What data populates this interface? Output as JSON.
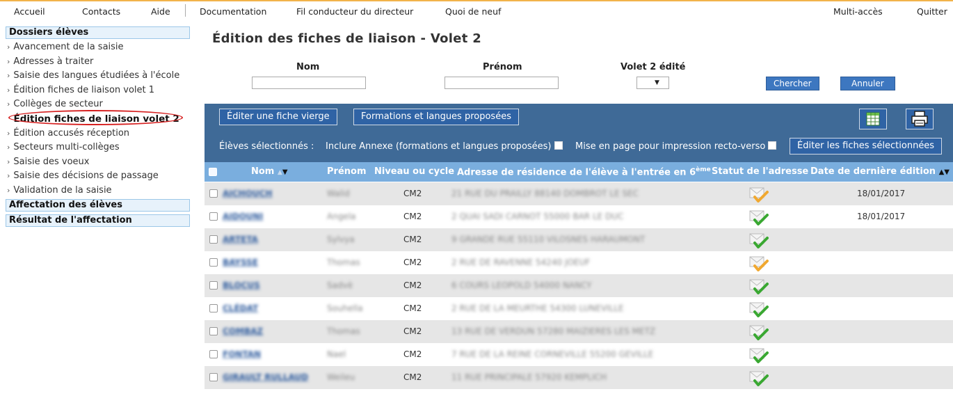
{
  "topmenu": {
    "left": [
      "Accueil",
      "Contacts",
      "Aide",
      "Documentation",
      "Fil conducteur du directeur",
      "Quoi de neuf"
    ],
    "right": [
      "Multi-accès",
      "Quitter"
    ]
  },
  "sidebar": {
    "section1": "Dossiers élèves",
    "items": [
      "Avancement de la saisie",
      "Adresses à traiter",
      "Saisie des langues étudiées à l'école",
      "Édition fiches de liaison volet 1",
      "Collèges de secteur",
      "Édition fiches de liaison volet 2",
      "Édition accusés réception",
      "Secteurs multi-collèges",
      "Saisie des voeux",
      "Saisie des décisions de passage",
      "Validation de la saisie"
    ],
    "active_index": 5,
    "section2": "Affectation des élèves",
    "section3": "Résultat de l'affectation",
    "chevron": "›"
  },
  "page": {
    "title": "Édition des fiches de liaison - Volet 2",
    "search": {
      "nom_label": "Nom",
      "nom_value": "",
      "prenom_label": "Prénom",
      "prenom_value": "",
      "volet_label": "Volet 2 édité",
      "volet_value": "",
      "search_button": "Chercher",
      "cancel_button": "Annuler"
    },
    "toolbar": {
      "blank_sheet_button": "Éditer une fiche vierge",
      "formations_button": "Formations et langues proposées",
      "selected_label": "Élèves sélectionnés :",
      "include_annex_label": "Inclure Annexe (formations et langues proposées)",
      "recto_verso_label": "Mise en page pour impression recto-verso",
      "edit_selected_button": "Éditer les fiches sélectionnées",
      "export_icon": "spreadsheet-icon",
      "print_icon": "printer-icon"
    },
    "table": {
      "headers": {
        "nom": "Nom",
        "prenom": "Prénom",
        "niveau": "Niveau ou cycle",
        "adresse": "Adresse de résidence de l'élève à l'entrée en 6",
        "adresse_sup": "ème",
        "statut": "Statut de l'adresse",
        "date": "Date de dernière édition"
      },
      "rows": [
        {
          "nom": "AICHOUCH",
          "prenom": "Walid",
          "niveau": "CM2",
          "adresse": "21 RUE DU PRAILLY 88140 DOMBROT LE SEC",
          "status": "warning",
          "date": "18/01/2017"
        },
        {
          "nom": "AIDOUNI",
          "prenom": "Angela",
          "niveau": "CM2",
          "adresse": "2 QUAI SADI CARNOT 55000 BAR LE DUC",
          "status": "ok",
          "date": "18/01/2017"
        },
        {
          "nom": "ARTETA",
          "prenom": "Sylvya",
          "niveau": "CM2",
          "adresse": "9 GRANDE RUE 55110 VILOSNES HARAUMONT",
          "status": "ok",
          "date": ""
        },
        {
          "nom": "BAYSSE",
          "prenom": "Thomas",
          "niveau": "CM2",
          "adresse": "2 RUE DE RAVENNE 54240 JOEUF",
          "status": "warning",
          "date": ""
        },
        {
          "nom": "BLOCUS",
          "prenom": "Sadvè",
          "niveau": "CM2",
          "adresse": "6 COURS LEOPOLD 54000 NANCY",
          "status": "ok",
          "date": ""
        },
        {
          "nom": "CLÉDAT",
          "prenom": "Souhella",
          "niveau": "CM2",
          "adresse": "2 RUE DE LA MEURTHE 54300 LUNEVILLE",
          "status": "ok",
          "date": ""
        },
        {
          "nom": "COMBAZ",
          "prenom": "Thomas",
          "niveau": "CM2",
          "adresse": "13 RUE DE VERDUN 57280 MAIZIERES LES METZ",
          "status": "ok",
          "date": ""
        },
        {
          "nom": "FONTAN",
          "prenom": "Nael",
          "niveau": "CM2",
          "adresse": "7 RUE DE LA REINE CORNEVILLE 55200 GEVILLE",
          "status": "ok",
          "date": ""
        },
        {
          "nom": "GIRAULT RULLAUD",
          "prenom": "Weileu",
          "niveau": "CM2",
          "adresse": "11 RUE PRINCIPALE 57920 KEMPLICH",
          "status": "ok",
          "date": ""
        }
      ]
    },
    "colors": {
      "panel": "#3f6a97",
      "header": "#7aaede",
      "button": "#2f63a5",
      "ok_check": "#3aa832",
      "warning_check": "#f0a830",
      "highlight_ring": "#d62020"
    }
  }
}
